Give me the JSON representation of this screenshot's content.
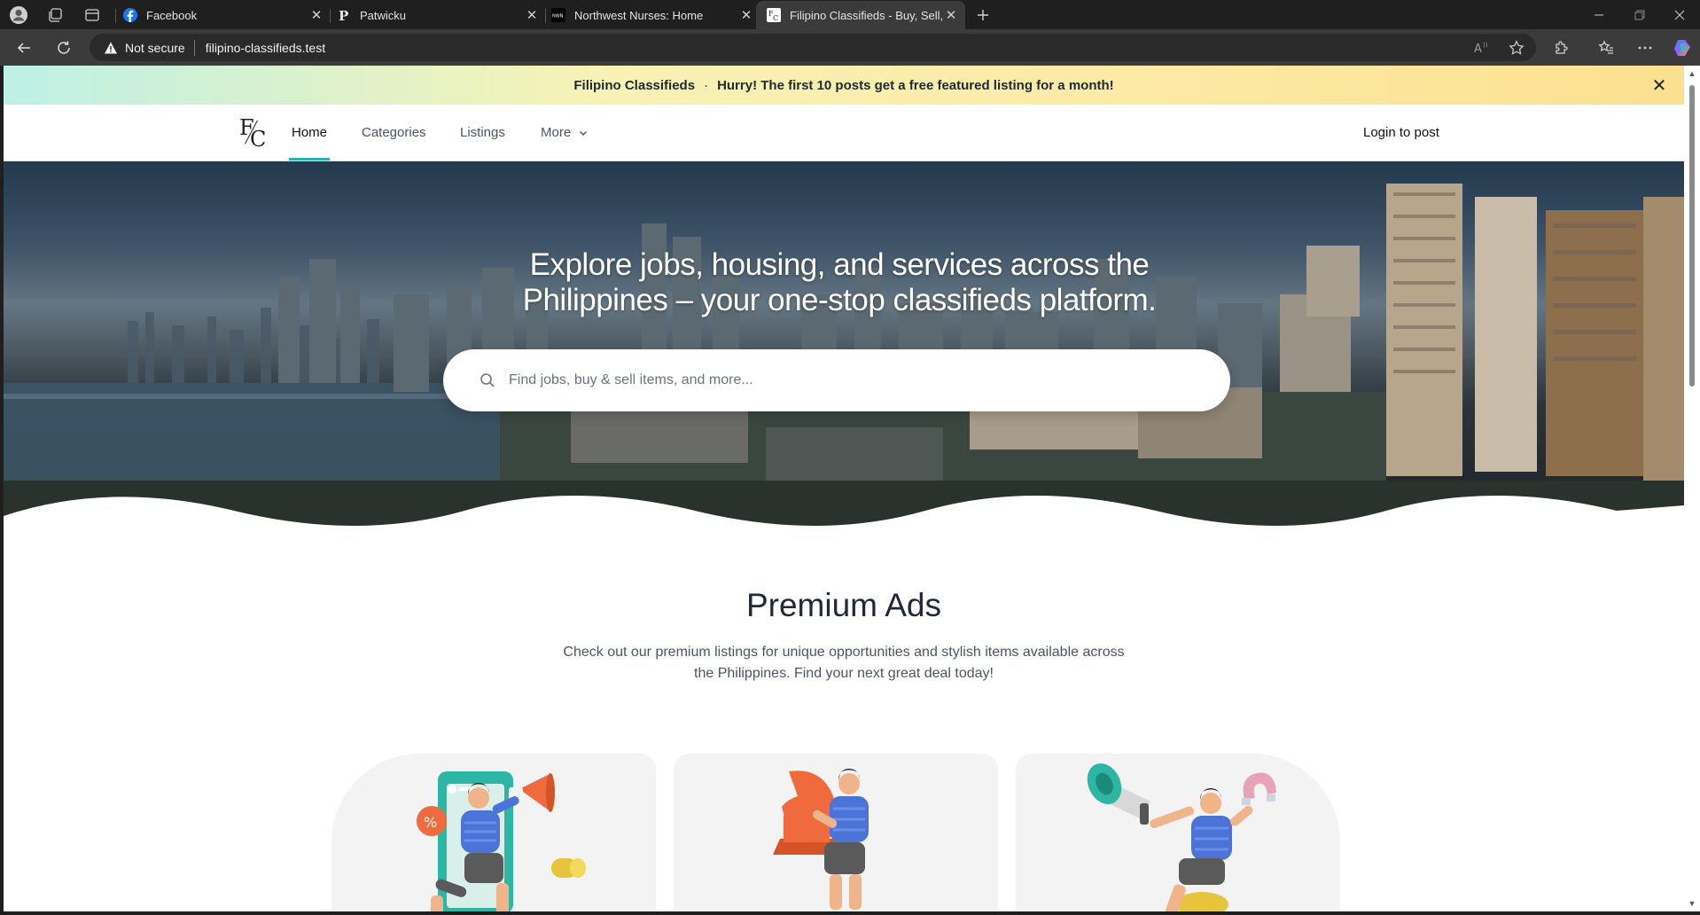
{
  "browser": {
    "tabs": [
      {
        "title": "Facebook",
        "icon": "facebook-icon"
      },
      {
        "title": "Patwicku",
        "icon": "p-letter-icon"
      },
      {
        "title": "Northwest Nurses: Home",
        "icon": "nwn-icon"
      },
      {
        "title": "Filipino Classifieds - Buy, Sell, Rent",
        "icon": "fc-logo-icon",
        "active": true
      }
    ],
    "security_label": "Not secure",
    "url": "filipino-classifieds.test"
  },
  "announcement": {
    "brand": "Filipino Classifieds",
    "separator": "·",
    "message": "Hurry! The first 10 posts get a free featured listing for a month!"
  },
  "nav": {
    "logo_text": "F/C",
    "links": [
      "Home",
      "Categories",
      "Listings",
      "More"
    ],
    "active": "Home",
    "login_label": "Login to post"
  },
  "hero": {
    "title_line1": "Explore jobs, housing, and services across the",
    "title_line2": "Philippines – your one-stop classifieds platform.",
    "search_placeholder": "Find jobs, buy & sell items, and more..."
  },
  "premium": {
    "title": "Premium Ads",
    "description_line1": "Check out our premium listings for unique opportunities and stylish items available across",
    "description_line2": "the Philippines. Find your next great deal today!"
  },
  "cards": [
    {
      "illustration": "promo-phone-megaphone-illustration"
    },
    {
      "illustration": "chess-knight-illustration"
    },
    {
      "illustration": "megaphone-magnet-illustration"
    }
  ],
  "colors": {
    "accent": "#2bb3b0",
    "heading": "#1f2937",
    "body_text": "#4b5563"
  }
}
